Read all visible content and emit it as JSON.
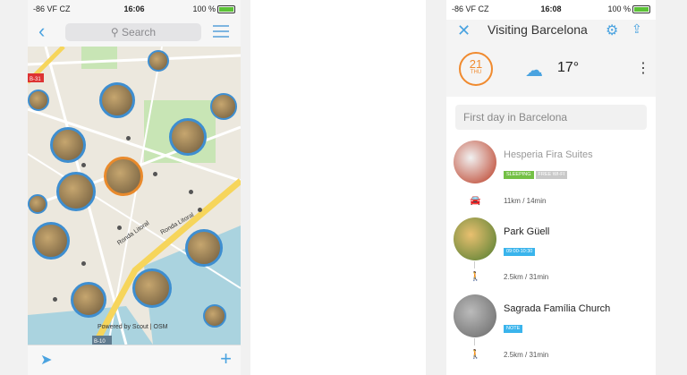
{
  "left_phone": {
    "status": {
      "carrier": "-86 VF CZ",
      "time": "16:06",
      "battery": "100 %"
    },
    "search": {
      "placeholder": "Search"
    },
    "map_credit": "Powered by Scout | OSM",
    "road_labels": [
      "Ronda Litoral",
      "Ronda Litoral"
    ],
    "map_badges": [
      "B-31",
      "B-10"
    ]
  },
  "right_phone": {
    "status": {
      "carrier": "-86 VF CZ",
      "time": "16:08",
      "battery": "100 %"
    },
    "title": "Visiting Barcelona",
    "date": {
      "day": "21",
      "weekday": "THU"
    },
    "temperature": "17°",
    "day_name": {
      "placeholder": "First day in Barcelona"
    },
    "stops": [
      {
        "name": "Hesperia Fira Suites",
        "badges": [
          "SLEEPING",
          "FREE WI-FI"
        ],
        "leg_mode": "car",
        "leg": "11km / 14min"
      },
      {
        "name": "Park Güell",
        "badges": [
          "09:00-10:30"
        ],
        "leg_mode": "walk",
        "leg": "2.5km / 31min"
      },
      {
        "name": "Sagrada Família Church",
        "badges": [
          "NOTE"
        ],
        "leg_mode": "walk",
        "leg": "2.5km / 31min"
      }
    ]
  },
  "colors": {
    "accent": "#4aa3e0",
    "date_orange": "#f08a2e",
    "map_road": "#f6d55b",
    "water": "#aad3df"
  }
}
